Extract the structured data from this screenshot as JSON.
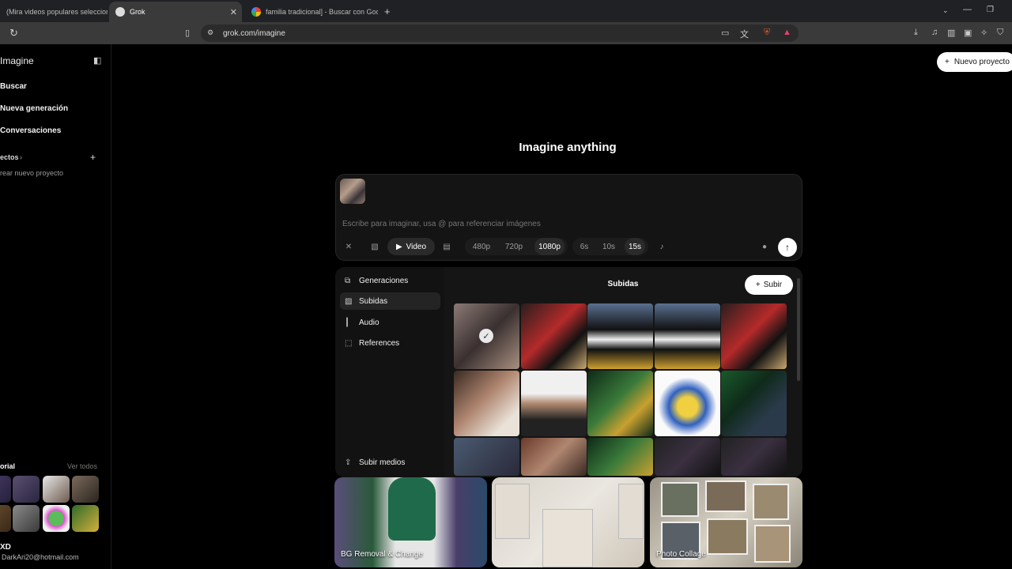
{
  "browser": {
    "tabs": [
      {
        "title": "(Mira videos populares selecciona",
        "active": false
      },
      {
        "title": "Grok",
        "active": true
      },
      {
        "title": "familia tradicional] - Buscar con Goo",
        "active": false
      }
    ],
    "url": "grok.com/imagine"
  },
  "sidebar": {
    "app_title": "Imagine",
    "items": [
      {
        "label": "Buscar"
      },
      {
        "label": "Nueva generación"
      },
      {
        "label": "Conversaciones"
      }
    ],
    "projects_label": "ectos",
    "new_project_link": "rear nuevo proyecto",
    "history_label": "orial",
    "view_all": "Ver todos",
    "user": {
      "name": "XD",
      "email": "DarkAri20@hotmail.com"
    }
  },
  "header": {
    "new_project_button": "Nuevo proyecto"
  },
  "main": {
    "title": "Imagine anything",
    "prompt_placeholder": "Escribe para imaginar, usa @ para referenciar imágenes",
    "mode_label": "Video",
    "resolutions": [
      "480p",
      "720p",
      "1080p"
    ],
    "selected_resolution": "1080p",
    "durations": [
      "6s",
      "10s",
      "15s"
    ],
    "selected_duration": "15s"
  },
  "media_panel": {
    "nav": [
      {
        "label": "Generaciones",
        "icon": "generations-icon"
      },
      {
        "label": "Subidas",
        "icon": "uploads-icon"
      },
      {
        "label": "Audio",
        "icon": "audio-icon"
      },
      {
        "label": "References",
        "icon": "references-icon"
      }
    ],
    "selected_nav": "Subidas",
    "upload_media": "Subir medios",
    "title": "Subidas",
    "upload_button": "Subir"
  },
  "templates": [
    {
      "label": "BG Removal & Change"
    },
    {
      "label": ""
    },
    {
      "label": "Photo Collage"
    }
  ],
  "colors": {
    "accent": "#ffffff",
    "background": "#000000",
    "panel": "#151515"
  }
}
